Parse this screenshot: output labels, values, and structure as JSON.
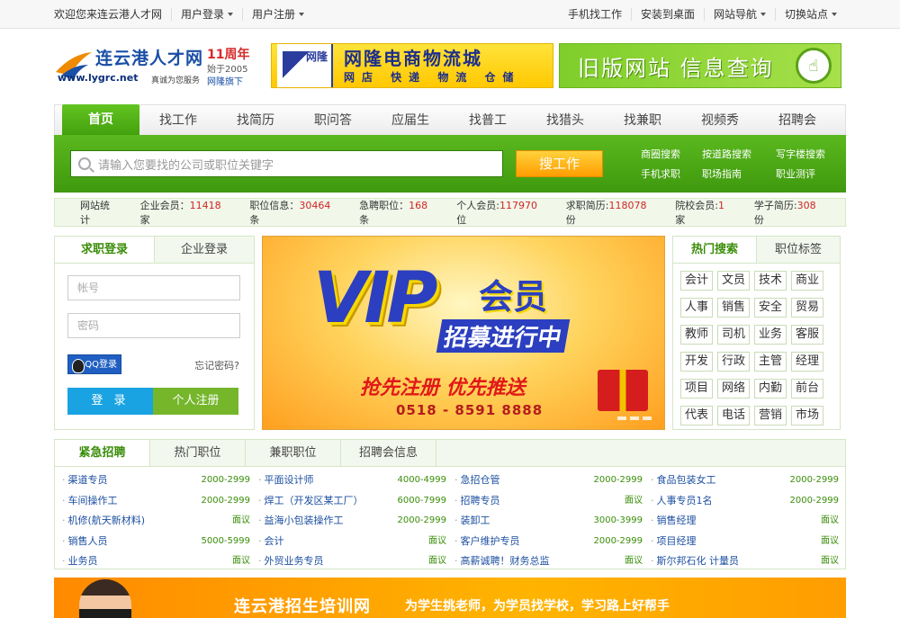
{
  "topbar": {
    "welcome": "欢迎您来连云港人才网",
    "login": "用户登录",
    "register": "用户注册",
    "mobile_job": "手机找工作",
    "install": "安装到桌面",
    "site_nav": "网站导航",
    "switch_site": "切换站点"
  },
  "logo": {
    "name": "连云港人才网",
    "url": "www.lygrc.net",
    "slogan": "真诚为您服务",
    "anniversary": "11周年",
    "since": "始于2005",
    "brand": "网隆旗下"
  },
  "ad1": {
    "logo_text": "网隆",
    "title": "网隆电商物流城",
    "subtitle": "网店 快递 物流 仓储"
  },
  "ad2": {
    "text": "旧版网站 信息查询"
  },
  "nav": [
    "首页",
    "找工作",
    "找简历",
    "职问答",
    "应届生",
    "找普工",
    "找猎头",
    "找兼职",
    "视频秀",
    "招聘会"
  ],
  "search": {
    "placeholder": "请输入您要找的公司或职位关键字",
    "button": "搜工作",
    "links": [
      "商圈搜索",
      "按道路搜索",
      "写字楼搜索",
      "手机求职",
      "职场指南",
      "职业测评"
    ]
  },
  "stats": {
    "label": "网站统计",
    "items": [
      {
        "name": "企业会员：",
        "value": "11418",
        "unit": "家"
      },
      {
        "name": "职位信息：",
        "value": "30464",
        "unit": "条"
      },
      {
        "name": "急聘职位：",
        "value": "168",
        "unit": "条"
      },
      {
        "name": "个人会员:",
        "value": "117970",
        "unit": "位"
      },
      {
        "name": "求职简历:",
        "value": "118078",
        "unit": "份"
      },
      {
        "name": "院校会员:",
        "value": "1",
        "unit": "家"
      },
      {
        "name": "学子简历:",
        "value": "308",
        "unit": "份"
      }
    ]
  },
  "login": {
    "tab_jobseeker": "求职登录",
    "tab_company": "企业登录",
    "account_placeholder": "帐号",
    "password_placeholder": "密码",
    "qq": "QQ登录",
    "forgot": "忘记密码?",
    "login_button": "登 录",
    "register_button": "个人注册"
  },
  "banner": {
    "vip": "VIP",
    "member": "会员",
    "recruit": "招募进行中",
    "slogan": "抢先注册  优先推送",
    "phone": "0518 - 8591 8888"
  },
  "hot": {
    "tab_hot": "热门搜索",
    "tab_tags": "职位标签",
    "tags": [
      "会计",
      "文员",
      "技术",
      "商业",
      "人事",
      "销售",
      "安全",
      "贸易",
      "教师",
      "司机",
      "业务",
      "客服",
      "开发",
      "行政",
      "主管",
      "经理",
      "项目",
      "网络",
      "内勤",
      "前台",
      "代表",
      "电话",
      "营销",
      "市场"
    ]
  },
  "jobs": {
    "tabs": [
      "紧急招聘",
      "热门职位",
      "兼职职位",
      "招聘会信息"
    ],
    "items": [
      {
        "title": "渠道专员",
        "pay": "2000-2999"
      },
      {
        "title": "平面设计师",
        "pay": "4000-4999"
      },
      {
        "title": "急招仓管",
        "pay": "2000-2999"
      },
      {
        "title": "食品包装女工",
        "pay": "2000-2999"
      },
      {
        "title": "车间操作工",
        "pay": "2000-2999"
      },
      {
        "title": "焊工（开发区某工厂）",
        "pay": "6000-7999"
      },
      {
        "title": "招聘专员",
        "pay": "面议"
      },
      {
        "title": "人事专员1名",
        "pay": "2000-2999"
      },
      {
        "title": "机修(航天新材料)",
        "pay": "面议"
      },
      {
        "title": "益海小包装操作工",
        "pay": "2000-2999"
      },
      {
        "title": "装卸工",
        "pay": "3000-3999"
      },
      {
        "title": "销售经理",
        "pay": "面议"
      },
      {
        "title": "销售人员",
        "pay": "5000-5999"
      },
      {
        "title": "会计",
        "pay": "面议"
      },
      {
        "title": "客户维护专员",
        "pay": "2000-2999"
      },
      {
        "title": "项目经理",
        "pay": "面议"
      },
      {
        "title": "业务员",
        "pay": "面议"
      },
      {
        "title": "外贸业务专员",
        "pay": "面议"
      },
      {
        "title": "高薪诚聘！财务总监",
        "pay": "面议"
      },
      {
        "title": "斯尔邦石化 计量员",
        "pay": "面议"
      }
    ]
  },
  "footer_banner": {
    "title": "连云港招生培训网",
    "slogan": "为学生挑老师，为学员找学校，学习路上好帮手"
  }
}
